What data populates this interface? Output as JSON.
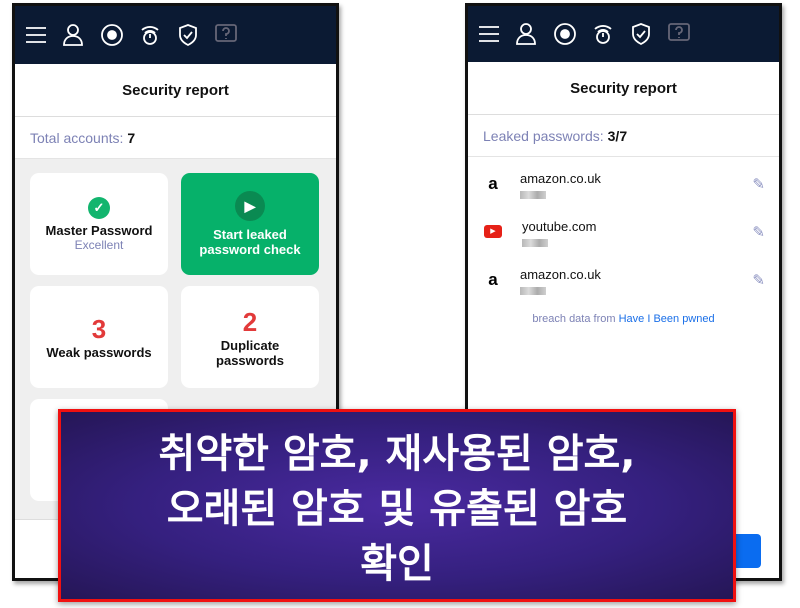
{
  "left_panel": {
    "nav_icons": [
      "menu-icon",
      "user-icon",
      "dashboard-icon",
      "timer-icon",
      "shield-check-icon",
      "help-icon"
    ],
    "title": "Security report",
    "total_label": "Total accounts:",
    "total_value": "7",
    "cards": {
      "master": {
        "label": "Master Password",
        "status": "Excellent"
      },
      "leak_check": {
        "label": "Start leaked password check"
      },
      "weak": {
        "count": "3",
        "label": "Weak passwords"
      },
      "duplicate": {
        "count": "2",
        "label": "Duplicate passwords"
      }
    }
  },
  "right_panel": {
    "title": "Security report",
    "leaked_label": "Leaked passwords:",
    "leaked_value": "3/7",
    "items": [
      {
        "site": "amazon.co.uk",
        "logo": "a"
      },
      {
        "site": "youtube.com",
        "logo": "▶"
      },
      {
        "site": "amazon.co.uk",
        "logo": "a"
      }
    ],
    "footer_text": "breach data from",
    "footer_link": "Have I Been pwned"
  },
  "overlay": {
    "line1": "취약한 암호, 재사용된 암호,",
    "line2": "오래된 암호 및 유출된 암호",
    "line3": "확인"
  },
  "colors": {
    "nav": "#0b1a33",
    "accent_green": "#06b16a",
    "danger": "#e23a3a",
    "link": "#1a6fe8",
    "overlay_border": "#f01010"
  }
}
